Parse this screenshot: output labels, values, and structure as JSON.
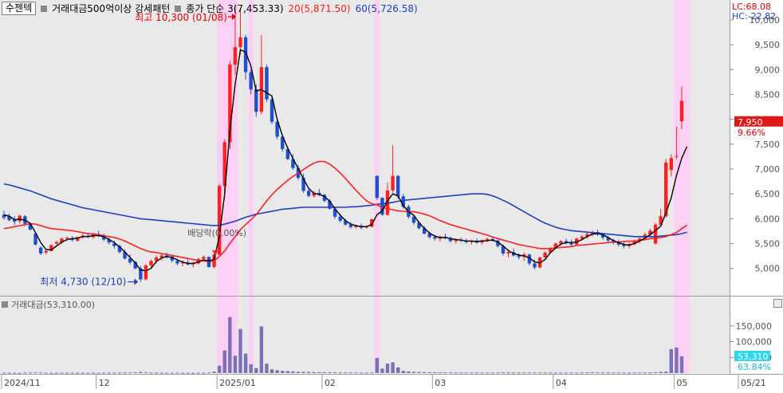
{
  "legend": {
    "stock": "수젠텍",
    "pattern": "거래대금500억이상 강세패턴",
    "close_label": "종가 단순 3(7,453.33)",
    "ma20_label": "20(5,871.50)",
    "ma60_label": "60(5,726.58)"
  },
  "volume_legend": "거래대금(53,310.00)",
  "colors": {
    "up": "#ff2020",
    "down": "#1f4fd1",
    "ma3": "#000000",
    "ma20": "#ff2020",
    "ma60": "#1c3fc8",
    "highlight": "#ffd0f5",
    "bg": "#e9e9e9",
    "volume": "#7a70b8"
  },
  "chart_data": {
    "type": "candlestick",
    "price_axis": {
      "ticks": [
        "10,000",
        "9,500",
        "9,000",
        "8,500",
        "8,000",
        "7,500",
        "7,000",
        "6,500",
        "6,000",
        "5,500",
        "5,000"
      ],
      "range": [
        4450,
        10400
      ]
    },
    "volume_axis": {
      "ticks": [
        "150,000",
        "100,000",
        "50,000"
      ],
      "range": [
        0,
        200000
      ]
    },
    "x_labels": [
      "2024/11",
      "12",
      "2025/01",
      "02",
      "03",
      "04",
      "05",
      "05/21"
    ],
    "right_panel": {
      "lc": "LC:68.08",
      "hc": "HC:-22.82",
      "current_price": "7,950",
      "change_pct": "9.66%",
      "current_volume": "53,310",
      "volume_pct": "63.84%"
    },
    "annotations": {
      "high": "최고 10,300 (01/08)",
      "low": "최저 4,730 (12/10)",
      "dividend": "배당락(0.00%)"
    },
    "candles_ohlc": [
      [
        6080,
        6160,
        5980,
        6020
      ],
      [
        6050,
        6100,
        5950,
        5970
      ],
      [
        5980,
        6050,
        5880,
        5940
      ],
      [
        5950,
        6080,
        5900,
        6060
      ],
      [
        6050,
        6070,
        5850,
        5900
      ],
      [
        5890,
        5920,
        5760,
        5780
      ],
      [
        5700,
        5710,
        5460,
        5480
      ],
      [
        5420,
        5440,
        5270,
        5300
      ],
      [
        5320,
        5380,
        5280,
        5350
      ],
      [
        5350,
        5480,
        5340,
        5470
      ],
      [
        5500,
        5560,
        5470,
        5530
      ],
      [
        5520,
        5620,
        5490,
        5600
      ],
      [
        5600,
        5640,
        5550,
        5620
      ],
      [
        5610,
        5650,
        5540,
        5570
      ],
      [
        5560,
        5640,
        5540,
        5630
      ],
      [
        5630,
        5700,
        5600,
        5660
      ],
      [
        5660,
        5720,
        5610,
        5630
      ],
      [
        5630,
        5720,
        5600,
        5700
      ],
      [
        5690,
        5760,
        5630,
        5650
      ],
      [
        5650,
        5700,
        5550,
        5580
      ],
      [
        5580,
        5620,
        5480,
        5520
      ],
      [
        5500,
        5560,
        5400,
        5450
      ],
      [
        5450,
        5480,
        5300,
        5330
      ],
      [
        5330,
        5380,
        5180,
        5200
      ],
      [
        5200,
        5280,
        5080,
        5120
      ],
      [
        5130,
        5150,
        4980,
        5000
      ],
      [
        5000,
        5050,
        4730,
        4780
      ],
      [
        4780,
        5090,
        4760,
        5060
      ],
      [
        5060,
        5180,
        5000,
        5150
      ],
      [
        5150,
        5260,
        5100,
        5220
      ],
      [
        5220,
        5300,
        5160,
        5260
      ],
      [
        5260,
        5320,
        5200,
        5240
      ],
      [
        5240,
        5280,
        5120,
        5160
      ],
      [
        5150,
        5200,
        5060,
        5100
      ],
      [
        5100,
        5160,
        5040,
        5120
      ],
      [
        5120,
        5180,
        5060,
        5080
      ],
      [
        5080,
        5140,
        5020,
        5100
      ],
      [
        5100,
        5210,
        5080,
        5190
      ],
      [
        5190,
        5260,
        5150,
        5230
      ],
      [
        5230,
        5240,
        5010,
        5030
      ],
      [
        5030,
        5310,
        5000,
        5280
      ],
      [
        5280,
        6700,
        5250,
        6660
      ],
      [
        6660,
        7600,
        6400,
        7540
      ],
      [
        7540,
        9180,
        7400,
        9100
      ],
      [
        9100,
        10300,
        8900,
        9450
      ],
      [
        9450,
        10200,
        9300,
        9650
      ],
      [
        9650,
        9700,
        8800,
        8950
      ],
      [
        8950,
        9000,
        8500,
        8600
      ],
      [
        8600,
        8700,
        8050,
        8150
      ],
      [
        8150,
        9700,
        8100,
        9050
      ],
      [
        9050,
        9100,
        8350,
        8400
      ],
      [
        8400,
        8450,
        7900,
        7950
      ],
      [
        7950,
        8000,
        7600,
        7650
      ],
      [
        7650,
        7700,
        7350,
        7400
      ],
      [
        7400,
        7450,
        7180,
        7200
      ],
      [
        7200,
        7300,
        6980,
        7020
      ],
      [
        7020,
        7080,
        6780,
        6820
      ],
      [
        6820,
        6900,
        6520,
        6560
      ],
      [
        6560,
        6600,
        6430,
        6460
      ],
      [
        6460,
        6560,
        6420,
        6520
      ],
      [
        6520,
        6600,
        6450,
        6480
      ],
      [
        6480,
        6500,
        6330,
        6360
      ],
      [
        6360,
        6400,
        6180,
        6200
      ],
      [
        6200,
        6240,
        6000,
        6040
      ],
      [
        6040,
        6100,
        5920,
        5960
      ],
      [
        5960,
        6000,
        5860,
        5880
      ],
      [
        5880,
        5930,
        5800,
        5830
      ],
      [
        5830,
        5880,
        5800,
        5860
      ],
      [
        5860,
        5900,
        5790,
        5820
      ],
      [
        5820,
        5860,
        5800,
        5840
      ],
      [
        5840,
        6000,
        5820,
        5990
      ],
      [
        6860,
        6870,
        6380,
        6420
      ],
      [
        6420,
        6430,
        6060,
        6080
      ],
      [
        6080,
        6730,
        6060,
        6570
      ],
      [
        6570,
        7480,
        6520,
        6860
      ],
      [
        6860,
        6880,
        6400,
        6450
      ],
      [
        6450,
        6500,
        6200,
        6240
      ],
      [
        6240,
        6280,
        6000,
        6040
      ],
      [
        6040,
        6080,
        5880,
        5920
      ],
      [
        5920,
        5950,
        5780,
        5810
      ],
      [
        5810,
        5850,
        5680,
        5700
      ],
      [
        5700,
        5740,
        5600,
        5630
      ],
      [
        5630,
        5680,
        5560,
        5600
      ],
      [
        5600,
        5660,
        5540,
        5640
      ],
      [
        5640,
        5700,
        5580,
        5610
      ],
      [
        5610,
        5640,
        5520,
        5550
      ],
      [
        5550,
        5600,
        5500,
        5580
      ],
      [
        5580,
        5620,
        5520,
        5560
      ],
      [
        5560,
        5600,
        5500,
        5530
      ],
      [
        5530,
        5580,
        5480,
        5560
      ],
      [
        5560,
        5600,
        5500,
        5520
      ],
      [
        5520,
        5580,
        5480,
        5570
      ],
      [
        5570,
        5620,
        5520,
        5590
      ],
      [
        5590,
        5640,
        5540,
        5560
      ],
      [
        5560,
        5580,
        5420,
        5450
      ],
      [
        5450,
        5480,
        5260,
        5300
      ],
      [
        5300,
        5360,
        5220,
        5330
      ],
      [
        5330,
        5400,
        5240,
        5260
      ],
      [
        5260,
        5300,
        5180,
        5230
      ],
      [
        5230,
        5320,
        5150,
        5280
      ],
      [
        5280,
        5290,
        5060,
        5100
      ],
      [
        5100,
        5180,
        4980,
        5020
      ],
      [
        5020,
        5240,
        5000,
        5220
      ],
      [
        5220,
        5340,
        5200,
        5320
      ],
      [
        5320,
        5430,
        5300,
        5410
      ],
      [
        5410,
        5520,
        5390,
        5500
      ],
      [
        5500,
        5570,
        5450,
        5550
      ],
      [
        5550,
        5600,
        5480,
        5520
      ],
      [
        5520,
        5580,
        5450,
        5480
      ],
      [
        5480,
        5620,
        5460,
        5600
      ],
      [
        5600,
        5680,
        5560,
        5640
      ],
      [
        5640,
        5720,
        5600,
        5690
      ],
      [
        5690,
        5760,
        5650,
        5730
      ],
      [
        5730,
        5780,
        5650,
        5680
      ],
      [
        5680,
        5700,
        5580,
        5620
      ],
      [
        5620,
        5650,
        5520,
        5560
      ],
      [
        5560,
        5600,
        5480,
        5520
      ],
      [
        5520,
        5580,
        5440,
        5480
      ],
      [
        5480,
        5540,
        5400,
        5450
      ],
      [
        5450,
        5520,
        5400,
        5490
      ],
      [
        5490,
        5580,
        5460,
        5560
      ],
      [
        5560,
        5640,
        5500,
        5600
      ],
      [
        5600,
        5720,
        5560,
        5680
      ],
      [
        5680,
        5800,
        5640,
        5760
      ],
      [
        5500,
        5920,
        5480,
        5880
      ],
      [
        5880,
        6200,
        5860,
        6050
      ],
      [
        6050,
        7200,
        6020,
        7130
      ],
      [
        6980,
        7300,
        6850,
        7220
      ],
      [
        7250,
        7850,
        7200,
        7260
      ],
      [
        7960,
        8660,
        7800,
        8370
      ]
    ],
    "volume": [
      1200,
      900,
      1000,
      800,
      1500,
      1800,
      2200,
      1600,
      1200,
      1000,
      900,
      1100,
      1200,
      1000,
      900,
      1100,
      1000,
      900,
      1000,
      1200,
      1100,
      1300,
      1500,
      1800,
      2000,
      2600,
      3800,
      2400,
      1500,
      1300,
      1100,
      1000,
      1200,
      1100,
      900,
      1000,
      900,
      1100,
      1200,
      2000,
      4800,
      23000,
      72000,
      178000,
      55000,
      140000,
      62000,
      28000,
      16000,
      148000,
      30000,
      12000,
      9000,
      7000,
      6000,
      5000,
      4000,
      3800,
      3500,
      3000,
      2800,
      2600,
      2400,
      2200,
      2000,
      1900,
      1800,
      1700,
      1600,
      1500,
      1800,
      48000,
      14000,
      30000,
      34000,
      18000,
      7000,
      5000,
      4000,
      3500,
      3000,
      2800,
      2600,
      2400,
      2200,
      2100,
      2000,
      1900,
      1800,
      1700,
      1600,
      1600,
      1500,
      1500,
      1800,
      2200,
      1800,
      1600,
      1500,
      1700,
      2000,
      1900,
      1800,
      1700,
      1600,
      1500,
      1500,
      1400,
      1600,
      1500,
      1800,
      2200,
      2500,
      2000,
      1800,
      1700,
      1600,
      1500,
      1500,
      1500,
      1600,
      1700,
      1800,
      2000,
      2400,
      3800,
      4500,
      76000,
      81000,
      53310
    ],
    "ma3": [
      6080,
      6050,
      5980,
      5990,
      5970,
      5910,
      5720,
      5520,
      5380,
      5370,
      5450,
      5530,
      5580,
      5600,
      5610,
      5640,
      5640,
      5660,
      5660,
      5640,
      5580,
      5520,
      5430,
      5330,
      5220,
      5110,
      4970,
      4950,
      5000,
      5140,
      5210,
      5240,
      5220,
      5170,
      5130,
      5100,
      5100,
      5130,
      5170,
      5150,
      5180,
      5660,
      6490,
      7770,
      8700,
      9400,
      9350,
      9070,
      8570,
      8600,
      8530,
      8470,
      8000,
      7670,
      7420,
      7210,
      7010,
      6800,
      6610,
      6510,
      6490,
      6450,
      6350,
      6200,
      6070,
      5960,
      5890,
      5860,
      5840,
      5840,
      5880,
      6080,
      6160,
      6360,
      6500,
      6460,
      6260,
      6140,
      6070,
      5920,
      5810,
      5710,
      5650,
      5620,
      5620,
      5600,
      5580,
      5570,
      5550,
      5550,
      5540,
      5550,
      5560,
      5570,
      5530,
      5450,
      5360,
      5300,
      5270,
      5250,
      5210,
      5130,
      5110,
      5180,
      5320,
      5410,
      5490,
      5520,
      5520,
      5530,
      5580,
      5640,
      5690,
      5700,
      5680,
      5620,
      5560,
      5520,
      5480,
      5470,
      5500,
      5550,
      5610,
      5680,
      5760,
      5850,
      6120,
      6420,
      6870,
      7220,
      7453
    ],
    "ma20": [
      5800,
      5820,
      5840,
      5860,
      5880,
      5900,
      5890,
      5860,
      5830,
      5800,
      5790,
      5780,
      5770,
      5760,
      5740,
      5720,
      5700,
      5690,
      5680,
      5660,
      5640,
      5620,
      5590,
      5550,
      5500,
      5450,
      5400,
      5360,
      5330,
      5320,
      5300,
      5280,
      5260,
      5240,
      5220,
      5200,
      5180,
      5160,
      5150,
      5140,
      5150,
      5240,
      5350,
      5500,
      5640,
      5780,
      5880,
      5980,
      6080,
      6220,
      6360,
      6480,
      6590,
      6680,
      6770,
      6850,
      6920,
      6990,
      7060,
      7120,
      7150,
      7150,
      7100,
      7020,
      6920,
      6810,
      6690,
      6570,
      6460,
      6360,
      6300,
      6280,
      6220,
      6200,
      6180,
      6160,
      6150,
      6140,
      6140,
      6120,
      6090,
      6060,
      6010,
      5960,
      5920,
      5880,
      5850,
      5820,
      5790,
      5760,
      5730,
      5700,
      5670,
      5630,
      5600,
      5570,
      5540,
      5510,
      5480,
      5460,
      5440,
      5420,
      5400,
      5400,
      5400,
      5410,
      5420,
      5430,
      5440,
      5460,
      5470,
      5480,
      5490,
      5500,
      5510,
      5520,
      5530,
      5530,
      5540,
      5550,
      5550,
      5560,
      5580,
      5600,
      5610,
      5620,
      5640,
      5680,
      5720,
      5800,
      5871
    ],
    "ma60": [
      6700,
      6680,
      6650,
      6620,
      6590,
      6560,
      6520,
      6480,
      6440,
      6400,
      6370,
      6340,
      6310,
      6280,
      6250,
      6220,
      6200,
      6180,
      6160,
      6140,
      6120,
      6100,
      6080,
      6060,
      6040,
      6020,
      6000,
      5990,
      5980,
      5970,
      5960,
      5950,
      5940,
      5930,
      5920,
      5910,
      5900,
      5890,
      5880,
      5870,
      5860,
      5870,
      5890,
      5920,
      5950,
      5990,
      6030,
      6060,
      6090,
      6110,
      6130,
      6150,
      6170,
      6190,
      6200,
      6210,
      6220,
      6230,
      6230,
      6230,
      6230,
      6230,
      6230,
      6230,
      6230,
      6230,
      6240,
      6240,
      6250,
      6260,
      6270,
      6290,
      6300,
      6310,
      6330,
      6350,
      6370,
      6380,
      6390,
      6400,
      6410,
      6420,
      6430,
      6440,
      6450,
      6460,
      6470,
      6480,
      6490,
      6500,
      6500,
      6500,
      6490,
      6460,
      6420,
      6370,
      6320,
      6260,
      6200,
      6140,
      6080,
      6020,
      5960,
      5910,
      5870,
      5830,
      5800,
      5780,
      5760,
      5750,
      5740,
      5730,
      5720,
      5710,
      5700,
      5690,
      5680,
      5670,
      5660,
      5650,
      5640,
      5640,
      5640,
      5640,
      5640,
      5650,
      5660,
      5670,
      5680,
      5700,
      5727
    ],
    "highlight_spans": [
      [
        41,
        44
      ],
      [
        47,
        47
      ],
      [
        71,
        71
      ],
      [
        128,
        130
      ]
    ],
    "dividend_index": 41,
    "high_index": 44,
    "low_index": 26
  }
}
